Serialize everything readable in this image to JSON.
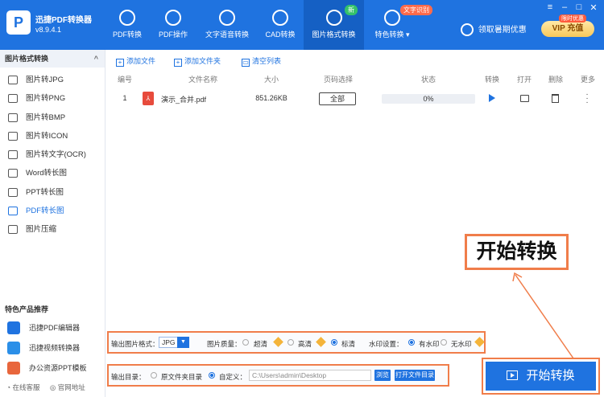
{
  "app": {
    "logo_letter": "P",
    "name": "迅捷PDF转换器",
    "version": "v8.9.4.1"
  },
  "nav": [
    {
      "label": "PDF转换",
      "icon": "arrows-swap-icon"
    },
    {
      "label": "PDF操作",
      "icon": "gear-icon"
    },
    {
      "label": "文字语音转换",
      "icon": "audio-wave-icon"
    },
    {
      "label": "CAD转换",
      "icon": "cad-icon"
    },
    {
      "label": "图片格式转换",
      "icon": "image-icon",
      "badge": "新"
    },
    {
      "label": "特色转换",
      "icon": "sparkle-icon",
      "badge": "文字识别"
    }
  ],
  "header": {
    "vip_offer": "领取暑期优惠",
    "vip_button": "充值",
    "vip_prefix": "VIP",
    "vip_tag": "限时优惠"
  },
  "window_controls": [
    "≡",
    "–",
    "□",
    "✕"
  ],
  "sidebar": {
    "section_title": "图片格式转换",
    "items": [
      "图片转JPG",
      "图片转PNG",
      "图片转BMP",
      "图片转ICON",
      "图片转文字(OCR)",
      "Word转长图",
      "PPT转长图",
      "PDF转长图",
      "图片压缩"
    ],
    "active_index": 7,
    "recommend_title": "特色产品推荐",
    "recommend": [
      {
        "label": "迅捷PDF编辑器",
        "color": "#1f73e0"
      },
      {
        "label": "迅捷视频转换器",
        "color": "#2b8fe8"
      },
      {
        "label": "办公资源PPT模板",
        "color": "#e8663c"
      }
    ],
    "footer": [
      "在线客服",
      "官网地址"
    ]
  },
  "toolbar": {
    "add_file": "添加文件",
    "add_folder": "添加文件夹",
    "clear_list": "清空列表"
  },
  "table": {
    "headers": [
      "编号",
      "文件名称",
      "大小",
      "页码选择",
      "状态",
      "转换",
      "打开",
      "删除",
      "更多"
    ],
    "rows": [
      {
        "index": "1",
        "name": "演示_合并.pdf",
        "size": "851.26KB",
        "pages": "全部",
        "progress_text": "0%",
        "progress": 0
      }
    ]
  },
  "settings": {
    "format_label": "输出图片格式：",
    "format_value": "JPG",
    "quality_label": "图片质量：",
    "quality_options": [
      "超清",
      "高清",
      "标清"
    ],
    "quality_selected": 2,
    "watermark_label": "水印设置：",
    "watermark_options": [
      "有水印",
      "无水印"
    ],
    "watermark_selected": 0,
    "output_label": "输出目录：",
    "output_options": [
      "原文件夹目录",
      "自定义："
    ],
    "output_selected": 1,
    "output_path": "C:\\Users\\admin\\Desktop",
    "browse": "浏览",
    "open_folder": "打开文件目录"
  },
  "start_button": "开始转换",
  "callout": "开始转换"
}
